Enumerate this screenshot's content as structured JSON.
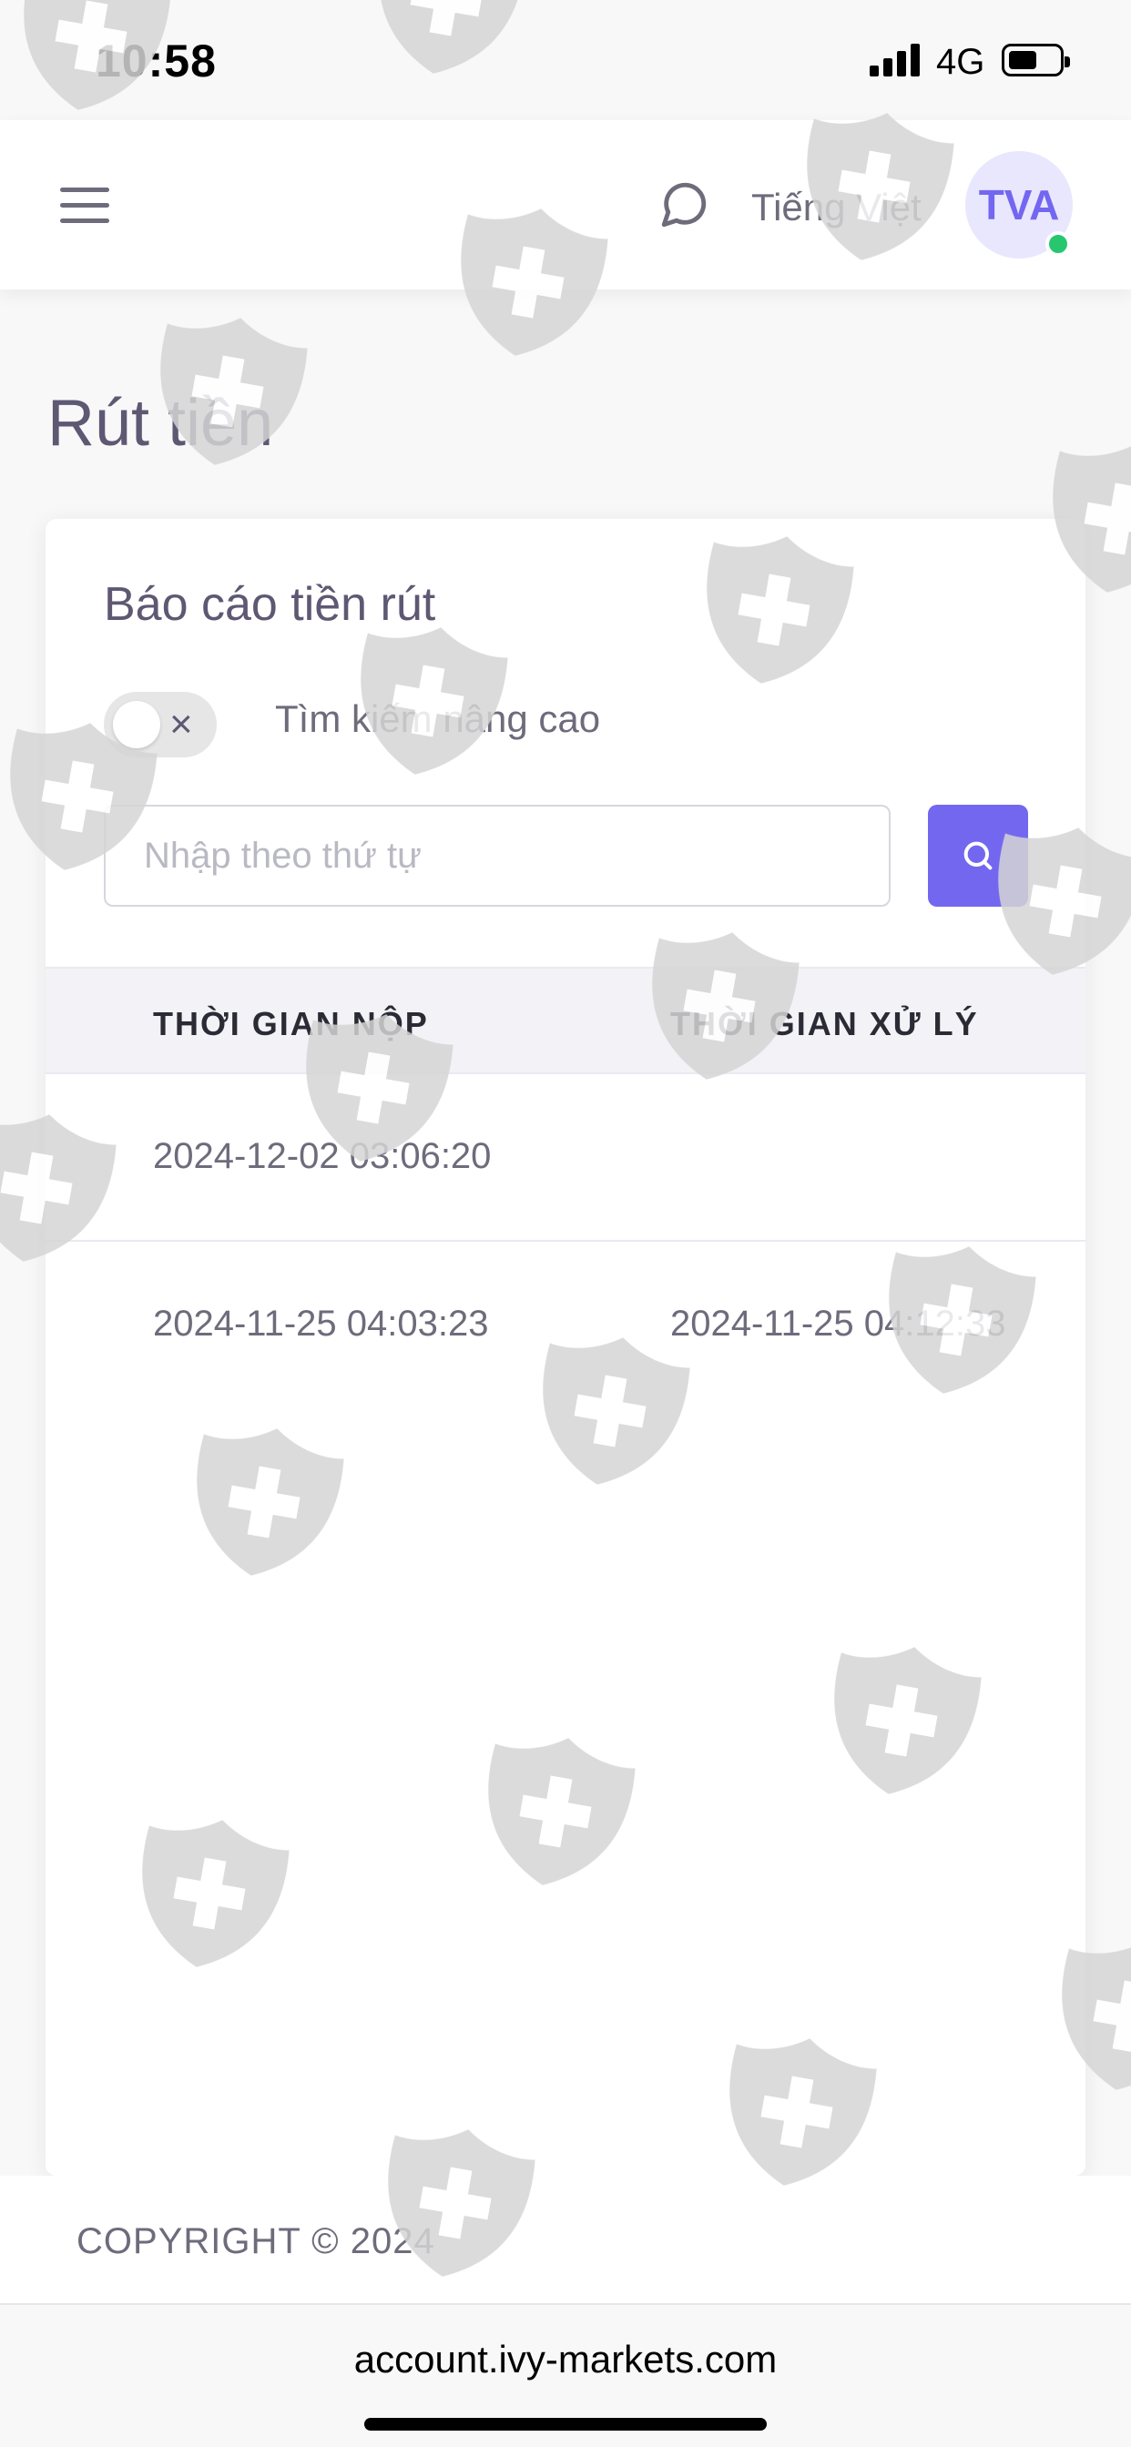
{
  "status_bar": {
    "time": "10:58",
    "network": "4G"
  },
  "header": {
    "language": "Tiếng Việt",
    "avatar_initials": "TVA"
  },
  "page": {
    "title": "Rút tiền"
  },
  "card": {
    "title": "Báo cáo tiền rút",
    "advanced_search_label": "Tìm kiếm nâng cao",
    "toggle_close_glyph": "×",
    "search_placeholder": "Nhập theo thứ tự"
  },
  "table": {
    "columns": [
      "THỜI GIAN NỘP",
      "THỜI GIAN XỬ LÝ"
    ],
    "rows": [
      {
        "submitted": "2024-12-02 03:06:20",
        "processed": ""
      },
      {
        "submitted": "2024-11-25 04:03:23",
        "processed": "2024-11-25 04:12:33"
      }
    ]
  },
  "footer": {
    "copyright": "COPYRIGHT © 2024"
  },
  "browser": {
    "url": "account.ivy-markets.com"
  },
  "colors": {
    "accent": "#7367f0",
    "online": "#28c76f",
    "text": "#6e6b7b",
    "heading": "#5e5873"
  }
}
